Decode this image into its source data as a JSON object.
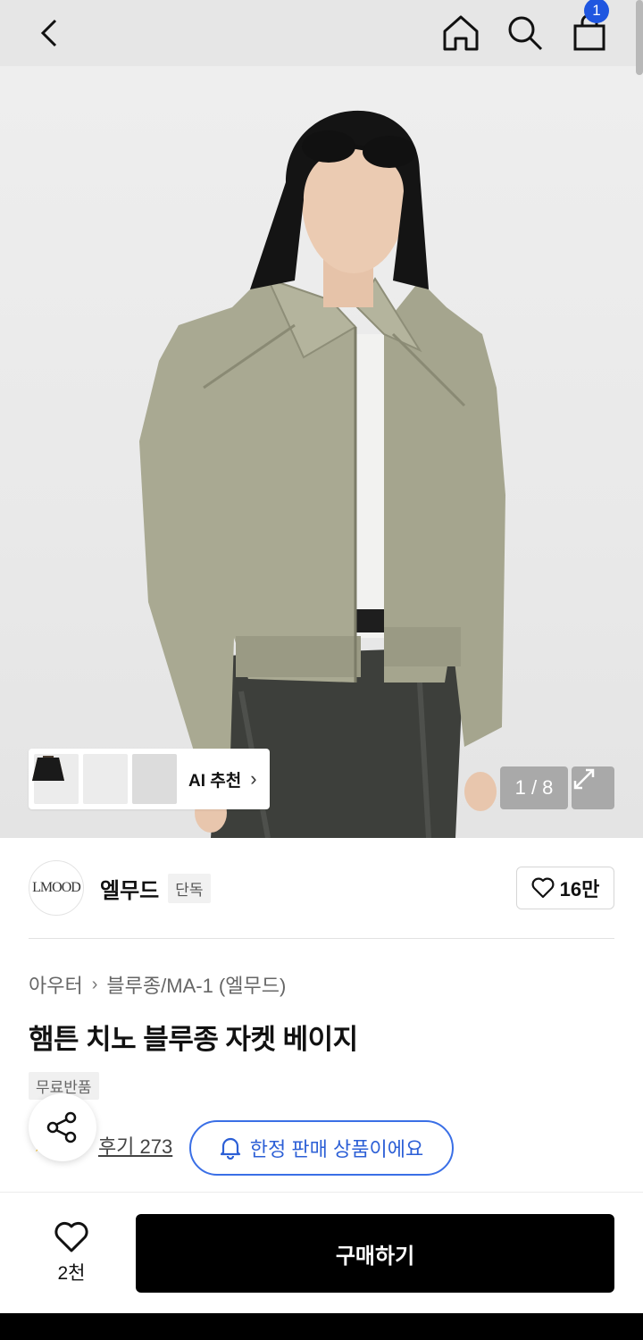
{
  "header": {
    "back_icon": "chevron-left-icon",
    "home_icon": "home-icon",
    "search_icon": "search-icon",
    "cart_icon": "shopping-bag-icon",
    "cart_badge": "1",
    "badge_color": "#1f56e0"
  },
  "hero": {
    "page_counter": "1 / 8",
    "expand_icon": "expand-icon",
    "ai_recommend": {
      "label": "AI 추천",
      "chevron": "›",
      "thumbnails": [
        "olive-jacket-thumb",
        "tan-jacket-thumb",
        "black-jacket-thumb"
      ]
    }
  },
  "brand": {
    "logo_text": "LMOOD",
    "name": "엘무드",
    "tag": "단독",
    "likes": "16만"
  },
  "product": {
    "breadcrumb": [
      "아우터",
      "블루종/MA-1 (엘무드)"
    ],
    "breadcrumb_sep": "›",
    "title": "햄튼 치노 블루종 자켓 베이지",
    "free_return_tag": "무료반품",
    "review_label": "후기 273",
    "limited_notice": "한정 판매 상품이에요"
  },
  "bottom": {
    "wish_count": "2천",
    "buy_label": "구매하기"
  },
  "colors": {
    "accent": "#2c5fd6",
    "primary_button": "#000000",
    "header_bg": "#e6e6e6"
  }
}
